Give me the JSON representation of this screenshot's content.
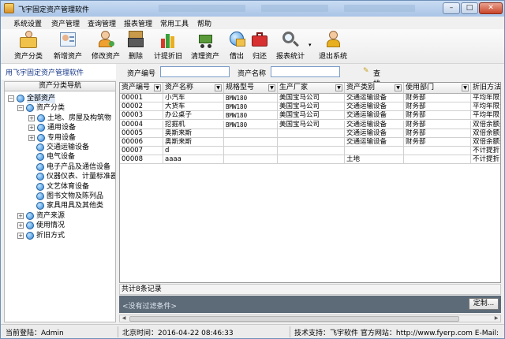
{
  "app": {
    "title": "飞宇固定资产管理软件"
  },
  "menu": [
    "系统设置",
    "资产管理",
    "查询管理",
    "报表管理",
    "常用工具",
    "帮助"
  ],
  "toolbar": [
    {
      "label": "资产分类",
      "icon": "people-folder-icon"
    },
    {
      "label": "新增资产",
      "icon": "add-user-card-icon"
    },
    {
      "label": "修改资产",
      "icon": "edit-user-icon"
    },
    {
      "label": "删除",
      "icon": "shredder-icon"
    },
    {
      "label": "计提折旧",
      "icon": "chart-bars-icon"
    },
    {
      "label": "清理资产",
      "icon": "cart-icon"
    },
    {
      "label": "借出",
      "icon": "globe-icon"
    },
    {
      "label": "归还",
      "icon": "toolbox-icon"
    },
    {
      "label": "报表统计",
      "icon": "magnifier-icon"
    },
    {
      "label": "退出系统",
      "icon": "exit-user-icon"
    }
  ],
  "caption": "用飞宇固定资产管理软件",
  "filter": {
    "code_label": "资产编号",
    "name_label": "资产名称",
    "code_value": "",
    "name_value": "",
    "find_label": "查找"
  },
  "tree": {
    "header": "资产分类导航",
    "nodes": [
      {
        "label": "全部资产",
        "level": 0,
        "expander": "-",
        "selected": true
      },
      {
        "label": "资产分类",
        "level": 1,
        "expander": "-"
      },
      {
        "label": "土地、房屋及构筑物",
        "level": 2,
        "expander": "+"
      },
      {
        "label": "通用设备",
        "level": 2,
        "expander": "+"
      },
      {
        "label": "专用设备",
        "level": 2,
        "expander": "+"
      },
      {
        "label": "交通运输设备",
        "level": 3,
        "expander": ""
      },
      {
        "label": "电气设备",
        "level": 3,
        "expander": ""
      },
      {
        "label": "电子产品及通信设备",
        "level": 3,
        "expander": ""
      },
      {
        "label": "仪器仪表、计量标准器",
        "level": 3,
        "expander": ""
      },
      {
        "label": "文艺体育设备",
        "level": 3,
        "expander": ""
      },
      {
        "label": "图书文物及陈列品",
        "level": 3,
        "expander": ""
      },
      {
        "label": "家具用具及其他类",
        "level": 3,
        "expander": ""
      },
      {
        "label": "资产来源",
        "level": 1,
        "expander": "+"
      },
      {
        "label": "使用情况",
        "level": 1,
        "expander": "+"
      },
      {
        "label": "折旧方式",
        "level": 1,
        "expander": "+"
      }
    ]
  },
  "table": {
    "columns": [
      "资产编号",
      "资产名称",
      "规格型号",
      "生产厂家",
      "资产类别",
      "使用部门",
      "折旧方法"
    ],
    "rows": [
      [
        "00001",
        "小汽车",
        "BMW180",
        "美国宝马公司",
        "交通运输设备",
        "财务部",
        "平均年限法"
      ],
      [
        "00002",
        "大货车",
        "BMW180",
        "美国宝马公司",
        "交通运输设备",
        "财务部",
        "平均年限法"
      ],
      [
        "00003",
        "办公桌子",
        "BMW180",
        "美国宝马公司",
        "交通运输设备",
        "财务部",
        "平均年限法"
      ],
      [
        "00004",
        "挖掘机",
        "BMW180",
        "美国宝马公司",
        "交通运输设备",
        "财务部",
        "双倍余额递"
      ],
      [
        "00005",
        "奥斯来斯",
        "",
        "",
        "交通运输设备",
        "财务部",
        "双倍余额递"
      ],
      [
        "00006",
        "奥斯来斯",
        "",
        "",
        "交通运输设备",
        "财务部",
        "双倍余额递"
      ],
      [
        "00007",
        "d",
        "",
        "",
        "",
        "",
        "不计提折旧"
      ],
      [
        "00008",
        "aaaa",
        "",
        "",
        "土地",
        "",
        "不计提折旧"
      ]
    ]
  },
  "count": "共计8条记录",
  "filter_status": "<没有过滤条件>",
  "customize_label": "定制...",
  "status": {
    "user": "当前登陆：Admin",
    "time": "北京时间：2016-04-22 08:46:33",
    "support": "技术支持：飞宇软件 官方网站：http://www.fyerp.com E-Mail:"
  }
}
